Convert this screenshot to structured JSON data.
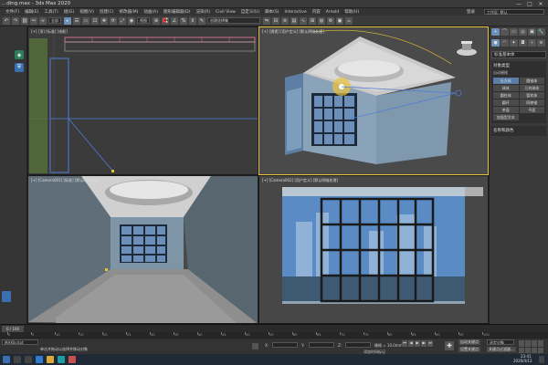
{
  "window": {
    "title": "...ding.max - 3ds Max 2020",
    "minimize": "—",
    "maximize": "□",
    "close": "✕"
  },
  "menu": {
    "items": [
      "文件(F)",
      "编辑(E)",
      "工具(T)",
      "组(G)",
      "视图(V)",
      "创建(C)",
      "修改器(M)",
      "动画(A)",
      "图形编辑器(D)",
      "渲染(R)",
      "Civil View",
      "自定义(U)",
      "脚本(S)",
      "Interactive",
      "内容",
      "Arnold",
      "帮助(H)"
    ],
    "user": "登录",
    "workspace": "工作区: 默认"
  },
  "toolbar": {
    "selection_filter": "全部",
    "view_dropdown": "视图",
    "named_selection": "创建选择集",
    "icons": [
      "undo-icon",
      "redo-icon",
      "link-icon",
      "unlink-icon",
      "bind-icon",
      "select-icon",
      "select-by-name-icon",
      "region-icon",
      "move-icon",
      "rotate-icon",
      "scale-icon",
      "snap-icon",
      "angle-snap-icon",
      "percent-snap-icon",
      "mirror-icon",
      "align-icon",
      "layer-icon",
      "curve-editor-icon",
      "schematic-icon",
      "material-icon",
      "render-setup-icon",
      "render-icon"
    ]
  },
  "left_strip": {
    "buttons": [
      "create-selection-icon",
      "shield-icon"
    ]
  },
  "viewports": {
    "top": "[+] [顶] [标准] [线框]",
    "perspective": "[+] [透视] [用户定义] [默认明暗处理]",
    "camera": "[+] [Camera001] [标准] [默认明暗处理]",
    "camera2": "[+] [Camera002] [用户定义] [默认明暗处理]"
  },
  "command_panel": {
    "tabs": [
      "+",
      "⌒",
      "▭",
      "◎",
      "▣",
      "🔧"
    ],
    "category": "标准基本体",
    "object_type_header": "对象类型",
    "auto_grid": "自动栅格",
    "buttons": [
      {
        "label": "长方体",
        "selected": true
      },
      {
        "label": "圆锥体",
        "selected": false
      },
      {
        "label": "球体",
        "selected": false
      },
      {
        "label": "几何球体",
        "selected": false
      },
      {
        "label": "圆柱体",
        "selected": false
      },
      {
        "label": "管状体",
        "selected": false
      },
      {
        "label": "圆环",
        "selected": false
      },
      {
        "label": "四棱锥",
        "selected": false
      },
      {
        "label": "茶壶",
        "selected": false
      },
      {
        "label": "平面",
        "selected": false
      },
      {
        "label": "加强型文本",
        "selected": false
      }
    ],
    "name_color_header": "名称和颜色"
  },
  "timeline": {
    "slider": "0 / 100",
    "ticks": [
      "0",
      "5",
      "10",
      "15",
      "20",
      "25",
      "30",
      "35",
      "40",
      "45",
      "50",
      "55",
      "60",
      "65",
      "70",
      "75",
      "80",
      "85",
      "90",
      "95",
      "100"
    ]
  },
  "status": {
    "mode": "MAXScript",
    "message": "单击并拖动以选择并移动对象",
    "x_label": "X:",
    "y_label": "Y:",
    "z_label": "Z:",
    "grid": "栅格 = 10.0mm",
    "auto_key": "自动关键点",
    "set_key": "设置关键点",
    "selected": "选定对象",
    "key_filters": "关键点过滤器...",
    "add_time_tag": "添加时间标记"
  },
  "taskbar": {
    "time": "23:41",
    "date": "2020/4/12"
  }
}
